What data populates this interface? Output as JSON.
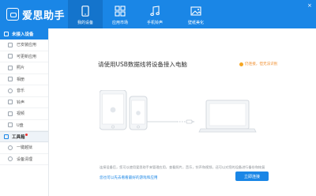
{
  "app": {
    "title": "爱思助手"
  },
  "header": {
    "tabs": [
      {
        "label": "我的设备",
        "icon": "phone-icon",
        "active": true
      },
      {
        "label": "应用市场",
        "icon": "apps-grid-icon",
        "active": false
      },
      {
        "label": "手机铃声",
        "icon": "music-note-icon",
        "active": false
      },
      {
        "label": "壁纸美化",
        "icon": "picture-icon",
        "active": false
      }
    ],
    "window_controls": {
      "close": "×"
    }
  },
  "sidebar": {
    "device_header": "未接入设备",
    "items": [
      {
        "label": "已安装应用",
        "icon": "app-icon"
      },
      {
        "label": "可更新应用",
        "icon": "update-icon"
      },
      {
        "label": "照片",
        "icon": "photo-icon"
      },
      {
        "label": "相册",
        "icon": "album-icon"
      },
      {
        "label": "音乐",
        "icon": "music-icon"
      },
      {
        "label": "铃声",
        "icon": "bell-icon"
      },
      {
        "label": "视频",
        "icon": "video-icon"
      },
      {
        "label": "U盘",
        "icon": "usb-drive-icon"
      }
    ],
    "toolbox_header": "工具箱",
    "tool_items": [
      {
        "label": "一键越狱",
        "icon": "unlock-icon"
      },
      {
        "label": "设备清理",
        "icon": "clean-icon"
      }
    ]
  },
  "main": {
    "title": "请使用USB数据线将设备接入电脑",
    "hint": "仍连接，但无法识别",
    "description": "连接设备后，您可以使用爱思助手来管理应用，查看照片，音乐，铃声和视频，还可以对您的设备进行备份和恢复",
    "link": "您也可以先去看看最好的游戏和应用",
    "button": "立即连接"
  },
  "colors": {
    "brand": "#1a86e6",
    "brand_dark": "#1474cc",
    "hint": "#f08c2a"
  }
}
